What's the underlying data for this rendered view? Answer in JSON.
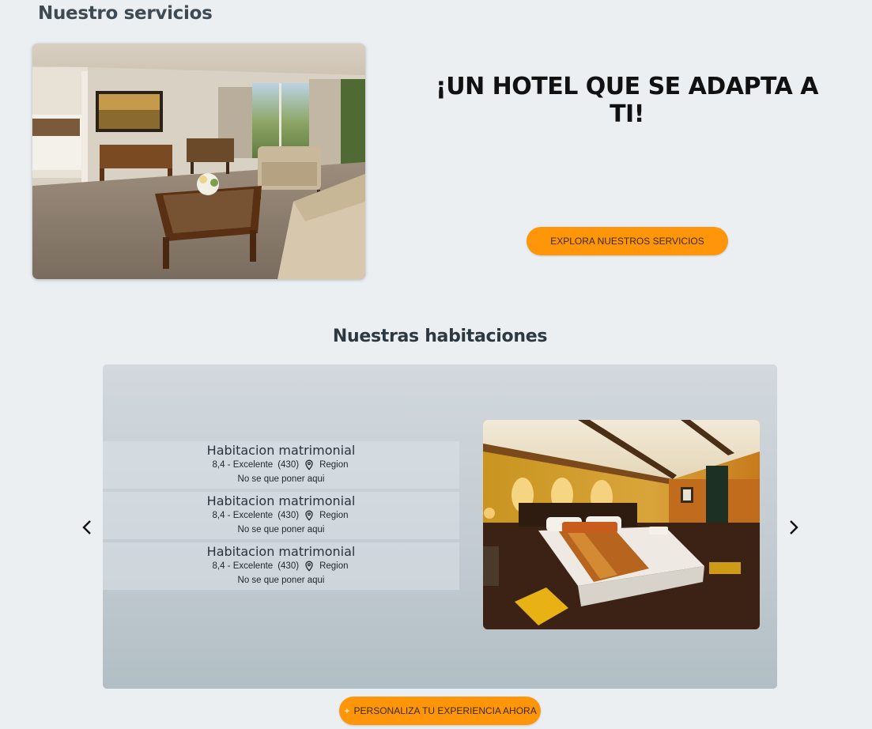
{
  "services": {
    "section_title": "Nuestro servicios",
    "headline": "¡UN HOTEL QUE SE ADAPTA A TI!",
    "cta_label": "EXPLORA NUESTROS SERVICIOS"
  },
  "rooms": {
    "section_title": "Nuestras habitaciones",
    "items": [
      {
        "title": "Habitacion matrimonial",
        "score": "8,4 - Excelente",
        "reviews": "(430)",
        "region": "Region",
        "description": "No se que poner aqui"
      },
      {
        "title": "Habitacion matrimonial",
        "score": "8,4 - Excelente",
        "reviews": "(430)",
        "region": "Region",
        "description": "No se que poner aqui"
      },
      {
        "title": "Habitacion matrimonial",
        "score": "8,4 - Excelente",
        "reviews": "(430)",
        "region": "Region",
        "description": "No se que poner aqui"
      }
    ],
    "prev_icon": "chevron-left-icon",
    "next_icon": "chevron-right-icon",
    "location_icon": "map-pin-icon"
  },
  "footer_cta": {
    "icon": "sparkle-icon",
    "label": "PERSONALIZA TU EXPERIENCIA AHORA"
  },
  "colors": {
    "background": "#ebeff2",
    "accent_orange": "#ff9609",
    "carousel_bg": "#c3ccd2"
  }
}
